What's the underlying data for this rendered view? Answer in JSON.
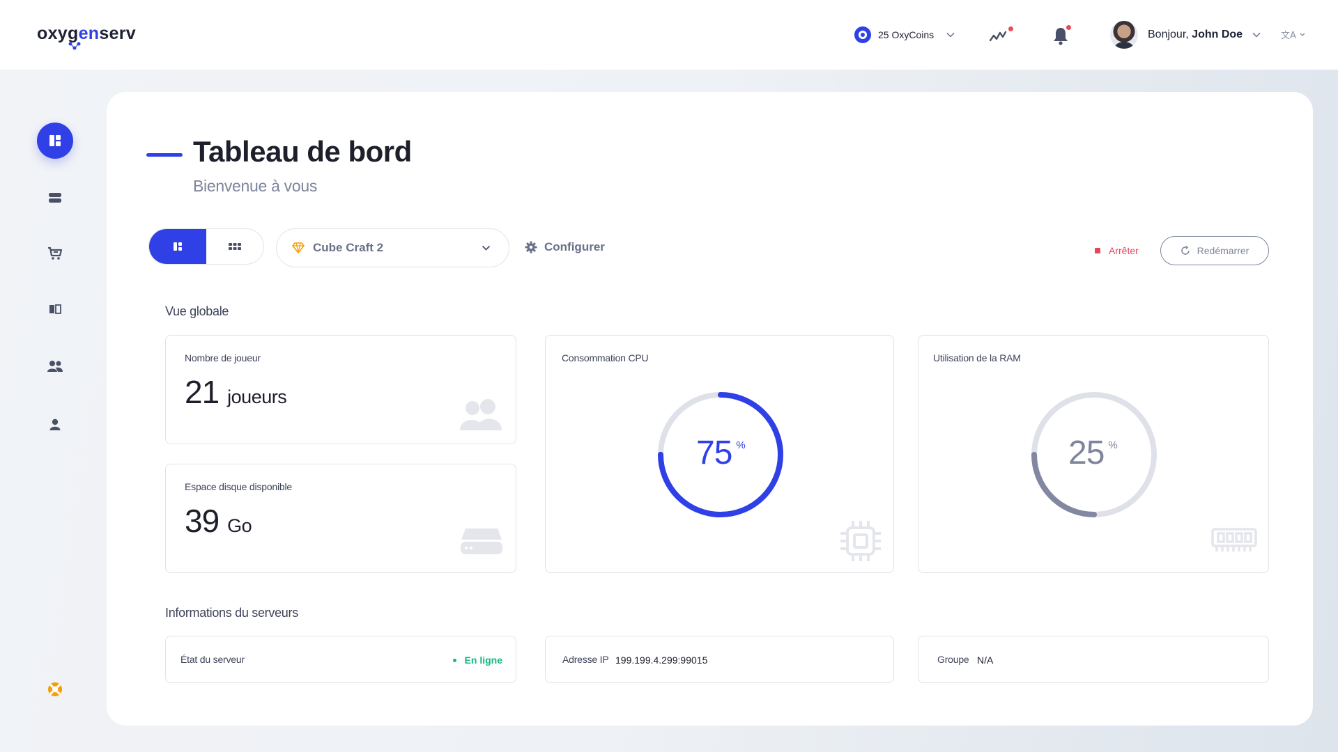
{
  "header": {
    "logo": {
      "prefix": "oxyg",
      "middle": "en",
      "suffix": "serv"
    },
    "coins_label": "25 OxyCoins",
    "greeting": "Bonjour,",
    "user_name": "John Doe",
    "language_icon": "translate-icon"
  },
  "sidebar": {
    "items": [
      {
        "name": "dashboard",
        "icon": "dashboard-icon",
        "active": true
      },
      {
        "name": "servers",
        "icon": "server-icon"
      },
      {
        "name": "shop",
        "icon": "cart-icon"
      },
      {
        "name": "docs",
        "icon": "book-icon"
      },
      {
        "name": "community",
        "icon": "users-icon"
      },
      {
        "name": "account",
        "icon": "user-icon"
      },
      {
        "name": "support",
        "icon": "lifebuoy-icon"
      }
    ]
  },
  "page": {
    "title": "Tableau de bord",
    "subtitle": "Bienvenue à vous"
  },
  "toolbar": {
    "server_name": "Cube Craft 2",
    "configure_label": "Configurer",
    "stop_label": "Arrêter",
    "restart_label": "Redémarrer"
  },
  "overview": {
    "title": "Vue globale",
    "players": {
      "label": "Nombre de joueur",
      "value": "21",
      "unit": "joueurs"
    },
    "disk": {
      "label": "Espace disque disponible",
      "value": "39",
      "unit": "Go"
    },
    "cpu": {
      "label": "Consommation CPU",
      "value": "75",
      "unit": "%",
      "percent": 75
    },
    "ram": {
      "label": "Utilisation de la RAM",
      "value": "25",
      "unit": "%",
      "percent": 25
    }
  },
  "server_info": {
    "title": "Informations du serveurs",
    "state_label": "État du serveur",
    "state_value": "En ligne",
    "ip_label": "Adresse IP",
    "ip_value": "199.199.4.299:99015",
    "group_label": "Groupe",
    "group_value": "N/A"
  },
  "colors": {
    "accent": "#2e40e6",
    "danger": "#e2475a",
    "success": "#10b981",
    "muted": "#7e859c"
  }
}
